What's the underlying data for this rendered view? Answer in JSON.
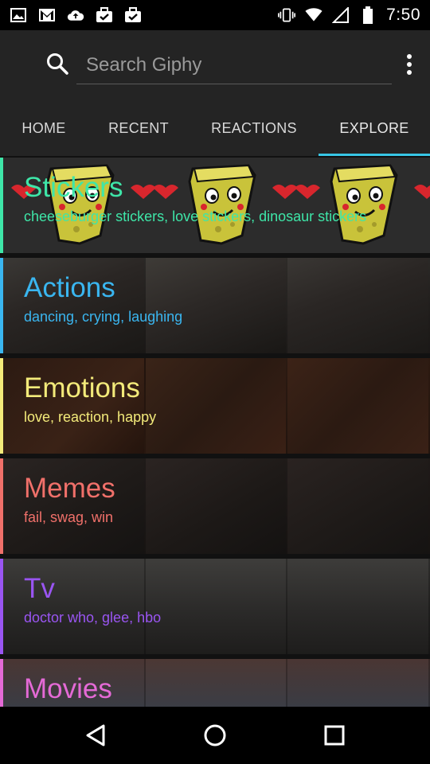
{
  "status_bar": {
    "time": "7:50",
    "left_icons": [
      "image-icon",
      "gmail-icon",
      "cloud-upload-icon",
      "briefcase-check-icon",
      "briefcase-check-icon"
    ],
    "right_icons": [
      "vibrate-icon",
      "wifi-icon",
      "signal-icon",
      "battery-icon"
    ]
  },
  "app_bar": {
    "search_placeholder": "Search Giphy",
    "tabs": [
      {
        "label": "HOME",
        "selected": false
      },
      {
        "label": "RECENT",
        "selected": false
      },
      {
        "label": "REACTIONS",
        "selected": false
      },
      {
        "label": "EXPLORE",
        "selected": true
      }
    ],
    "tab_indicator_color": "#38c6e6"
  },
  "categories": [
    {
      "title": "Stickers",
      "tags": "cheeseburger stickers, love stickers, dinosaur stickers",
      "color": "#3ee6a8"
    },
    {
      "title": "Actions",
      "tags": "dancing, crying, laughing",
      "color": "#3ab6f0"
    },
    {
      "title": "Emotions",
      "tags": "love, reaction, happy",
      "color": "#f3ea7a"
    },
    {
      "title": "Memes",
      "tags": "fail, swag, win",
      "color": "#f0706a"
    },
    {
      "title": "Tv",
      "tags": "doctor who, glee, hbo",
      "color": "#9a55f2"
    },
    {
      "title": "Movies",
      "tags": "",
      "color": "#e46ad6"
    }
  ],
  "nav_bar": {
    "icons": [
      "back-icon",
      "home-icon",
      "recents-icon"
    ]
  }
}
